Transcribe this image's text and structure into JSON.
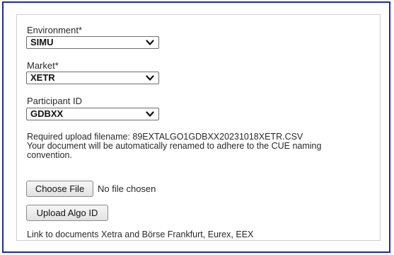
{
  "environment": {
    "label": "Environment*",
    "selected": "SIMU"
  },
  "market": {
    "label": "Market*",
    "selected": "XETR"
  },
  "participant": {
    "label": "Participant ID",
    "selected": "GDBXX"
  },
  "info": {
    "line1": "Required upload filename: 89EXTALGO1GDBXX20231018XETR.CSV",
    "line2": "Your document will be automatically renamed to adhere to the CUE naming",
    "line3": "convention."
  },
  "file_input": {
    "button_label": "Choose File",
    "status": "No file chosen"
  },
  "upload_button": {
    "label": "Upload Algo ID"
  },
  "documents": {
    "prefix": "Link to documents",
    "link1": "Xetra and Börse Frankfurt",
    "separator1": ",",
    "link2": "Eurex",
    "separator2": ",",
    "link3": "EEX"
  },
  "colors": {
    "frame_border": "#1f2aa0",
    "panel_border": "#cfcfcf"
  }
}
